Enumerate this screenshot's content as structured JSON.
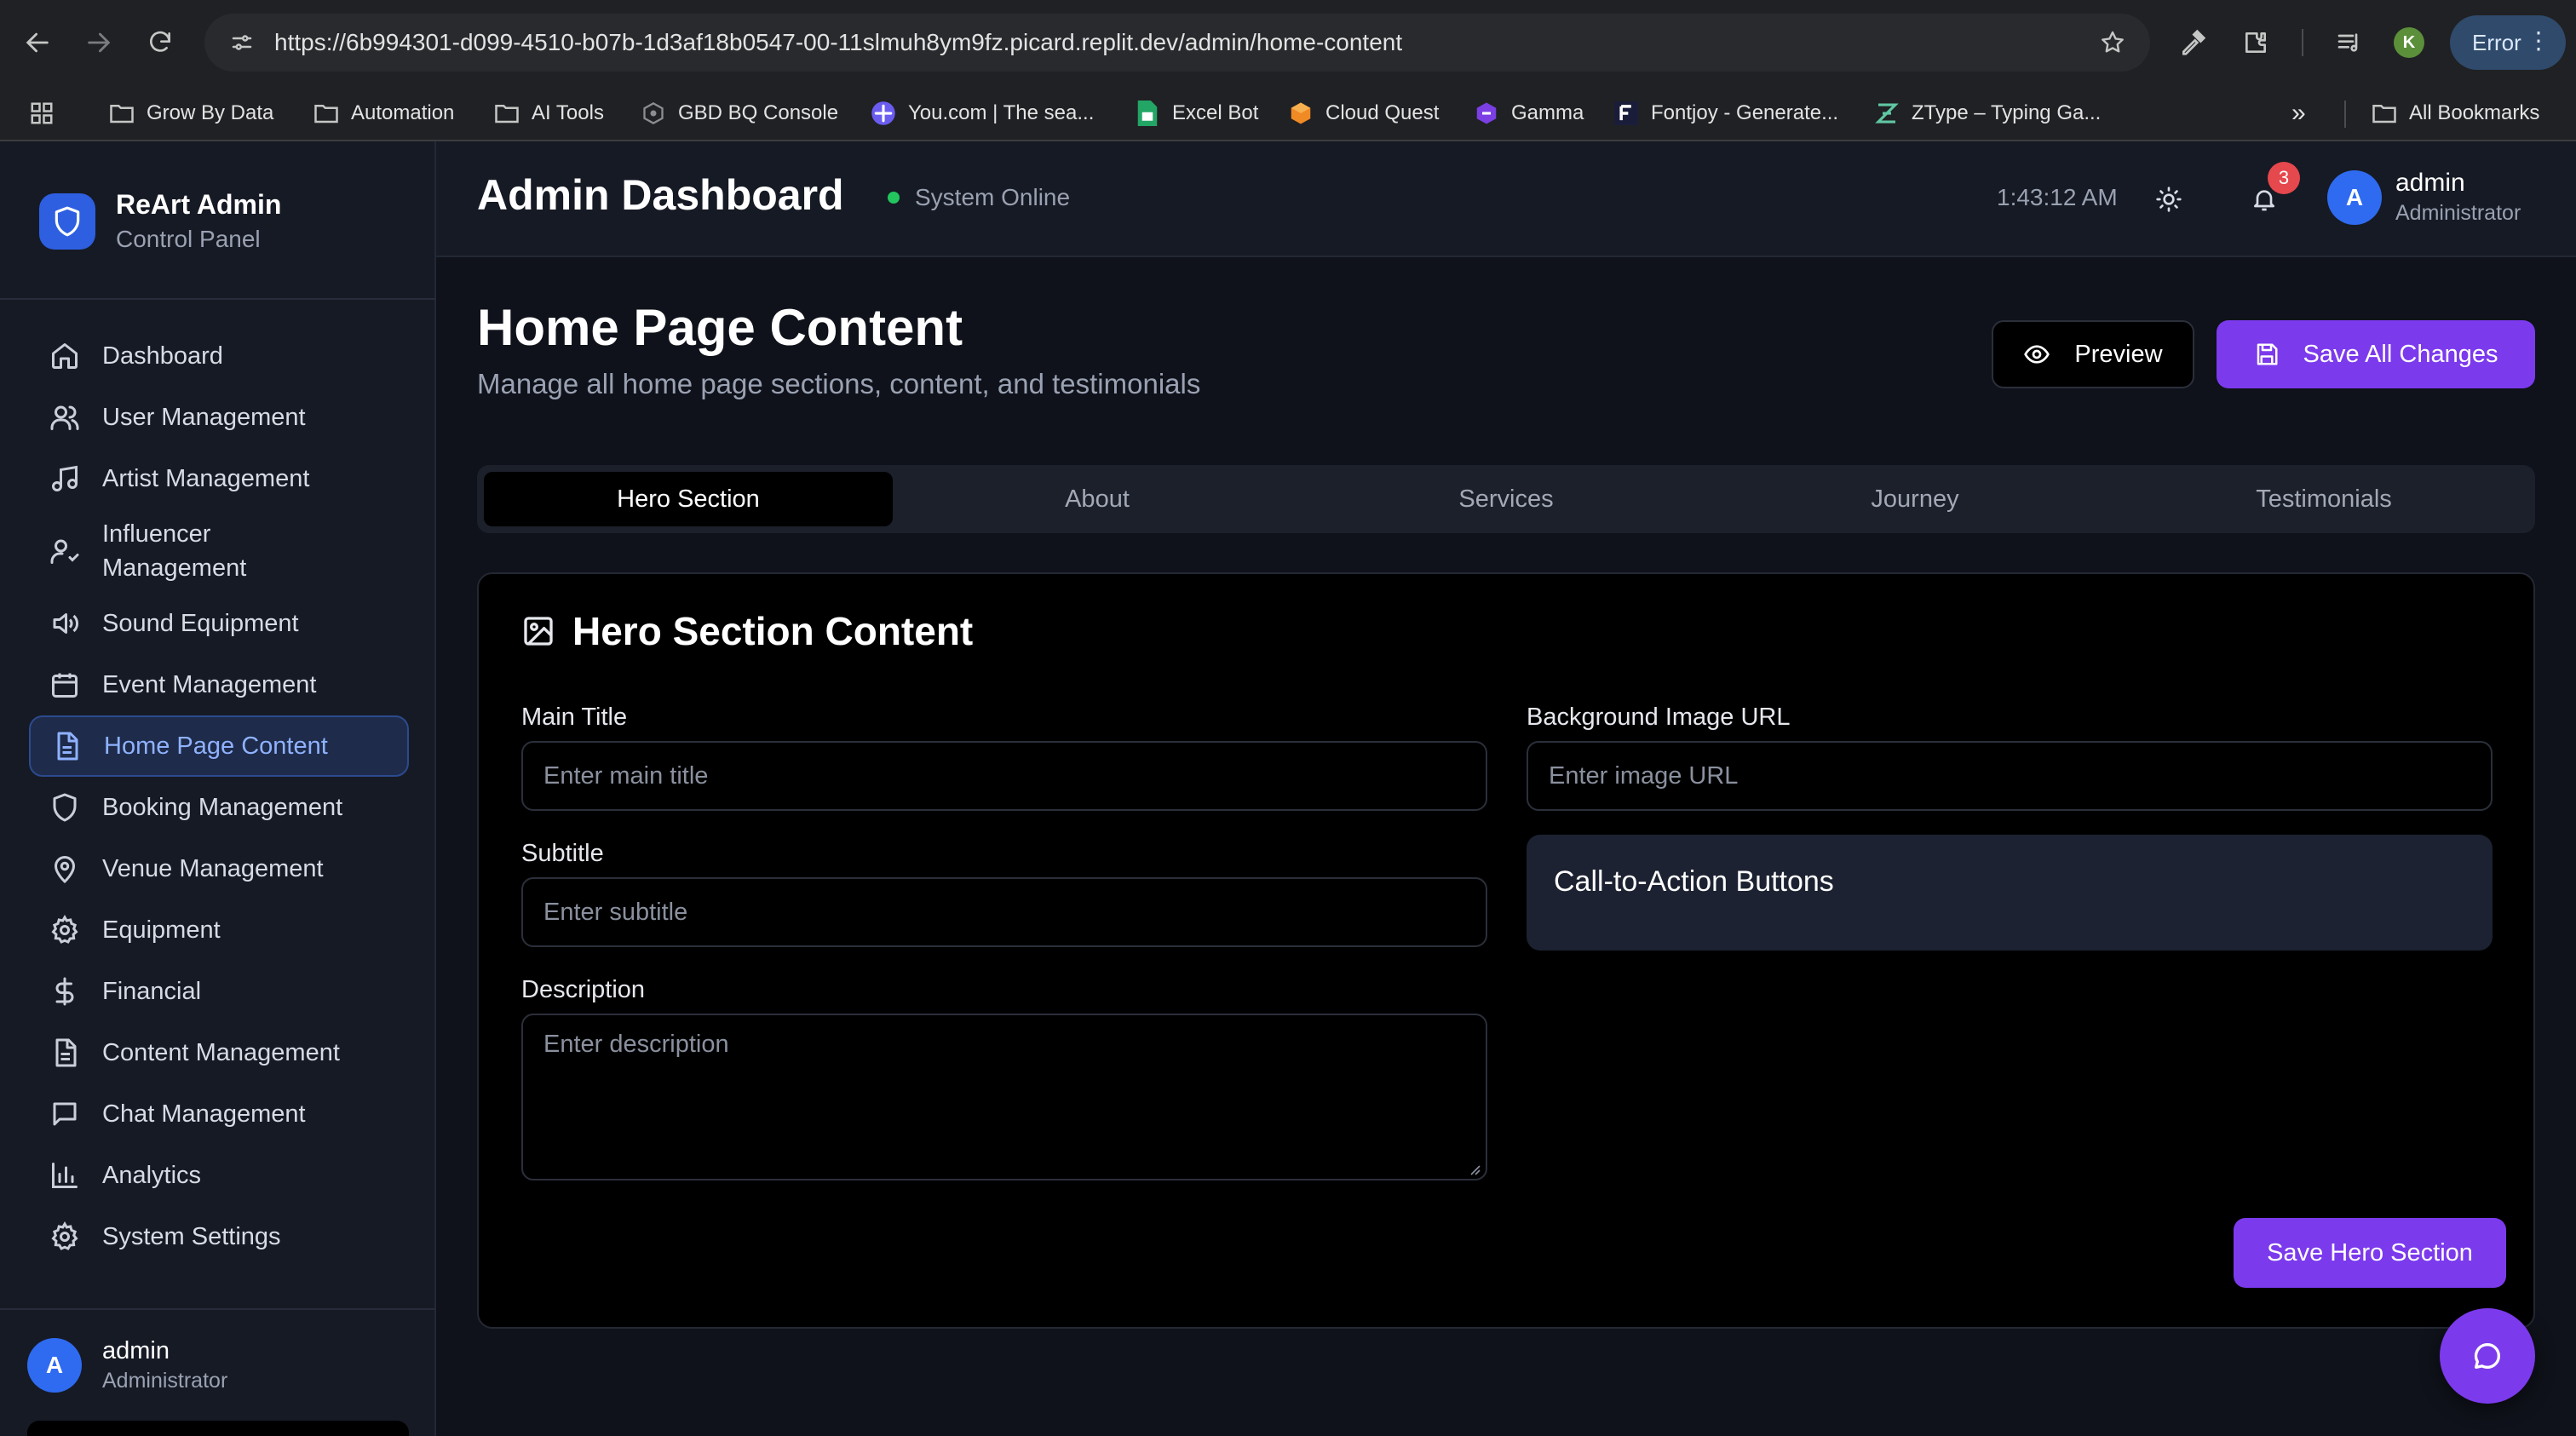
{
  "browser": {
    "url": "https://6b994301-d099-4510-b07b-1d3af18b0547-00-11slmuh8ym9fz.picard.replit.dev/admin/home-content",
    "profile_initial": "K",
    "error_label": "Error",
    "bookmarks": [
      {
        "label": "Grow By Data",
        "icon": "folder-icon"
      },
      {
        "label": "Automation",
        "icon": "folder-icon"
      },
      {
        "label": "AI Tools",
        "icon": "folder-icon"
      },
      {
        "label": "GBD BQ Console",
        "icon": "bigquery-icon"
      },
      {
        "label": "You.com | The sea...",
        "icon": "you-com-icon"
      },
      {
        "label": "Excel Bot",
        "icon": "sheets-icon"
      },
      {
        "label": "Cloud Quest",
        "icon": "cube-icon"
      },
      {
        "label": "Gamma",
        "icon": "gamma-icon"
      },
      {
        "label": "Fontjoy - Generate...",
        "icon": "fontjoy-icon"
      },
      {
        "label": "ZType – Typing Ga...",
        "icon": "ztype-icon"
      }
    ],
    "all_bookmarks_label": "All Bookmarks"
  },
  "sidebar": {
    "brand_title": "ReArt Admin",
    "brand_subtitle": "Control Panel",
    "items": [
      {
        "label": "Dashboard",
        "icon": "home-icon"
      },
      {
        "label": "User Management",
        "icon": "users-icon"
      },
      {
        "label": "Artist Management",
        "icon": "music-icon"
      },
      {
        "label": "Influencer Management",
        "icon": "user-check-icon"
      },
      {
        "label": "Sound Equipment",
        "icon": "speaker-icon"
      },
      {
        "label": "Event Management",
        "icon": "calendar-icon"
      },
      {
        "label": "Home Page Content",
        "icon": "document-icon",
        "active": true
      },
      {
        "label": "Booking Management",
        "icon": "shield-icon"
      },
      {
        "label": "Venue Management",
        "icon": "map-pin-icon"
      },
      {
        "label": "Equipment",
        "icon": "gear-icon"
      },
      {
        "label": "Financial",
        "icon": "dollar-icon"
      },
      {
        "label": "Content Management",
        "icon": "document-icon"
      },
      {
        "label": "Chat Management",
        "icon": "message-icon"
      },
      {
        "label": "Analytics",
        "icon": "bar-chart-icon"
      },
      {
        "label": "System Settings",
        "icon": "gear-icon"
      }
    ],
    "user": {
      "initial": "A",
      "name": "admin",
      "role": "Administrator"
    }
  },
  "header": {
    "title": "Admin Dashboard",
    "status": "System Online",
    "time": "1:43:12 AM",
    "notification_count": "3",
    "user": {
      "initial": "A",
      "name": "admin",
      "role": "Administrator"
    }
  },
  "page": {
    "title": "Home Page Content",
    "subtitle": "Manage all home page sections, content, and testimonials",
    "preview_label": "Preview",
    "save_all_label": "Save All Changes",
    "tabs": [
      "Hero Section",
      "About",
      "Services",
      "Journey",
      "Testimonials"
    ],
    "active_tab": "Hero Section"
  },
  "hero_card": {
    "title": "Hero Section Content",
    "main_title_label": "Main Title",
    "main_title_placeholder": "Enter main title",
    "subtitle_label": "Subtitle",
    "subtitle_placeholder": "Enter subtitle",
    "description_label": "Description",
    "description_placeholder": "Enter description",
    "bg_image_label": "Background Image URL",
    "bg_image_placeholder": "Enter image URL",
    "cta_title": "Call-to-Action Buttons",
    "save_label": "Save Hero Section"
  },
  "colors": {
    "accent": "#7c3aed",
    "brand_blue": "#2d5fe0",
    "status_online": "#22c55e",
    "badge_red": "#e5484d"
  }
}
